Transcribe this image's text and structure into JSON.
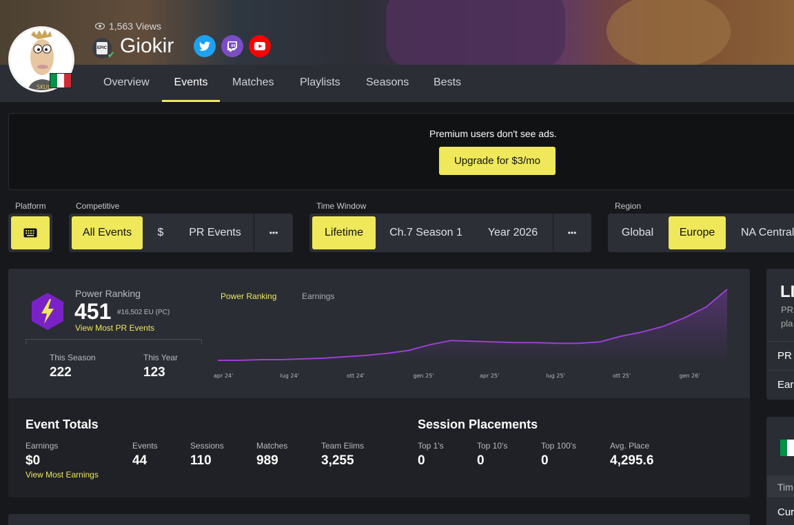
{
  "profile": {
    "views": "1,563 Views",
    "username": "Giokir",
    "platform_badge": "EPIC",
    "country_colors": [
      "#009246",
      "#ffffff",
      "#ce2b37"
    ]
  },
  "social": [
    {
      "name": "twitter-icon",
      "color": "#1da1f2"
    },
    {
      "name": "twitch-icon",
      "color": "#7b4cc4"
    },
    {
      "name": "youtube-icon",
      "color": "#ff0000"
    }
  ],
  "nav": {
    "tabs": [
      "Overview",
      "Events",
      "Matches",
      "Playlists",
      "Seasons",
      "Bests"
    ],
    "active": "Events"
  },
  "ad": {
    "text": "Premium users don't see ads.",
    "button": "Upgrade for $3/mo"
  },
  "filters": {
    "platform_label": "Platform",
    "competitive_label": "Competitive",
    "competitive": [
      "All Events",
      "$",
      "PR Events"
    ],
    "time_label": "Time Window",
    "time": [
      "Lifetime",
      "Ch.7 Season 1",
      "Year 2026"
    ],
    "region_label": "Region",
    "region": [
      "Global",
      "Europe",
      "NA Central"
    ],
    "more": "•••"
  },
  "power_ranking": {
    "label": "Power Ranking",
    "value": "451",
    "sub": "#16,502 EU (PC)",
    "link": "View Most PR Events",
    "this_season_label": "This Season",
    "this_season": "222",
    "this_year_label": "This Year",
    "this_year": "123"
  },
  "chart_tabs": [
    "Power Ranking",
    "Earnings"
  ],
  "chart_data": {
    "type": "area",
    "x_ticks": [
      "apr 24'",
      "lug 24'",
      "ott 24'",
      "gen 25'",
      "apr 25'",
      "lug 25'",
      "ott 25'",
      "gen 26'"
    ],
    "series": [
      {
        "values": [
          0,
          0,
          1,
          1,
          2,
          3,
          5,
          7,
          10,
          14,
          22,
          28,
          27,
          26,
          25,
          25,
          24,
          24,
          26,
          34,
          40,
          48,
          60,
          75,
          100
        ]
      }
    ]
  },
  "event_totals": {
    "title": "Event Totals",
    "stats": [
      {
        "label": "Earnings",
        "value": "$0"
      },
      {
        "label": "Events",
        "value": "44"
      },
      {
        "label": "Sessions",
        "value": "110"
      },
      {
        "label": "Matches",
        "value": "989"
      },
      {
        "label": "Team Elims",
        "value": "3,255"
      }
    ],
    "link": "View Most Earnings"
  },
  "session_placements": {
    "title": "Session Placements",
    "stats": [
      {
        "label": "Top 1's",
        "value": "0"
      },
      {
        "label": "Top 10's",
        "value": "0"
      },
      {
        "label": "Top 100's",
        "value": "0"
      },
      {
        "label": "Avg. Place",
        "value": "4,295.6"
      }
    ]
  },
  "right_panel": {
    "title_fragment": "LI",
    "line1": "PR",
    "line2": "pla",
    "row1": "PR",
    "row2": "Ear",
    "row3": "Tim",
    "row4": "Cur"
  },
  "colors": {
    "accent": "#eee85a",
    "chart_line": "#9b3fd6",
    "pr_icon": "#7a22c8"
  }
}
